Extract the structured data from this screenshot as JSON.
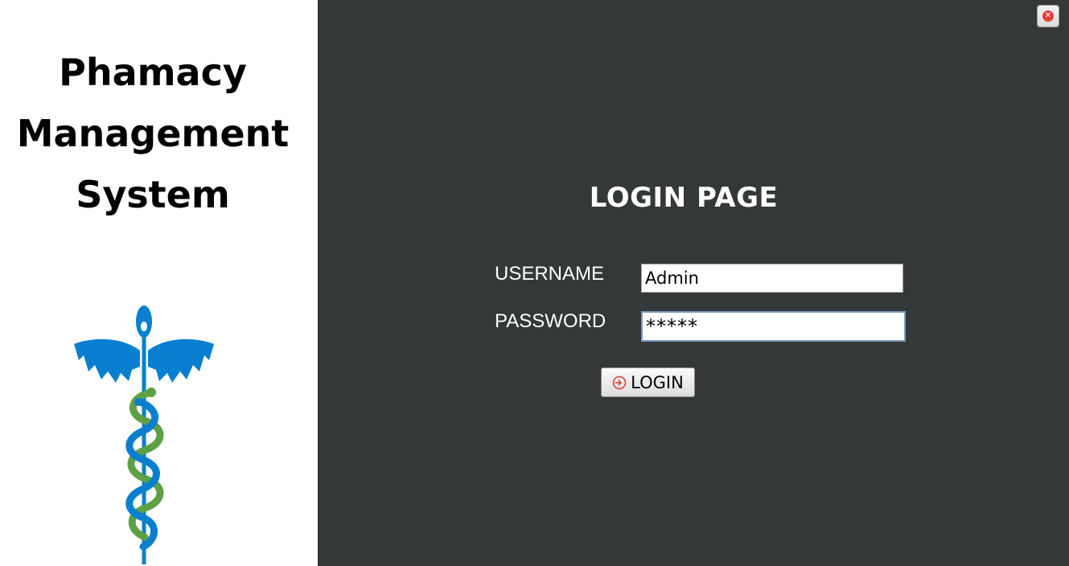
{
  "app": {
    "title_line1": "Phamacy",
    "title_line2": "Management",
    "title_line3": "System"
  },
  "logo": {
    "icon": "caduceus-icon",
    "colors": {
      "wings": "#0a7fd0",
      "snake_blue": "#0a7fd0",
      "snake_green": "#5da046"
    }
  },
  "window": {
    "close_icon": "close-icon"
  },
  "login": {
    "heading": "LOGIN PAGE",
    "username_label": "USERNAME",
    "username_value": "Admin",
    "password_label": "PASSWORD",
    "password_value": "*****",
    "button_label": "LOGIN",
    "button_icon": "login-icon"
  },
  "colors": {
    "left_bg": "#ffffff",
    "right_bg": "#353839",
    "text_light": "#ffffff",
    "accent_red": "#e0403a"
  }
}
